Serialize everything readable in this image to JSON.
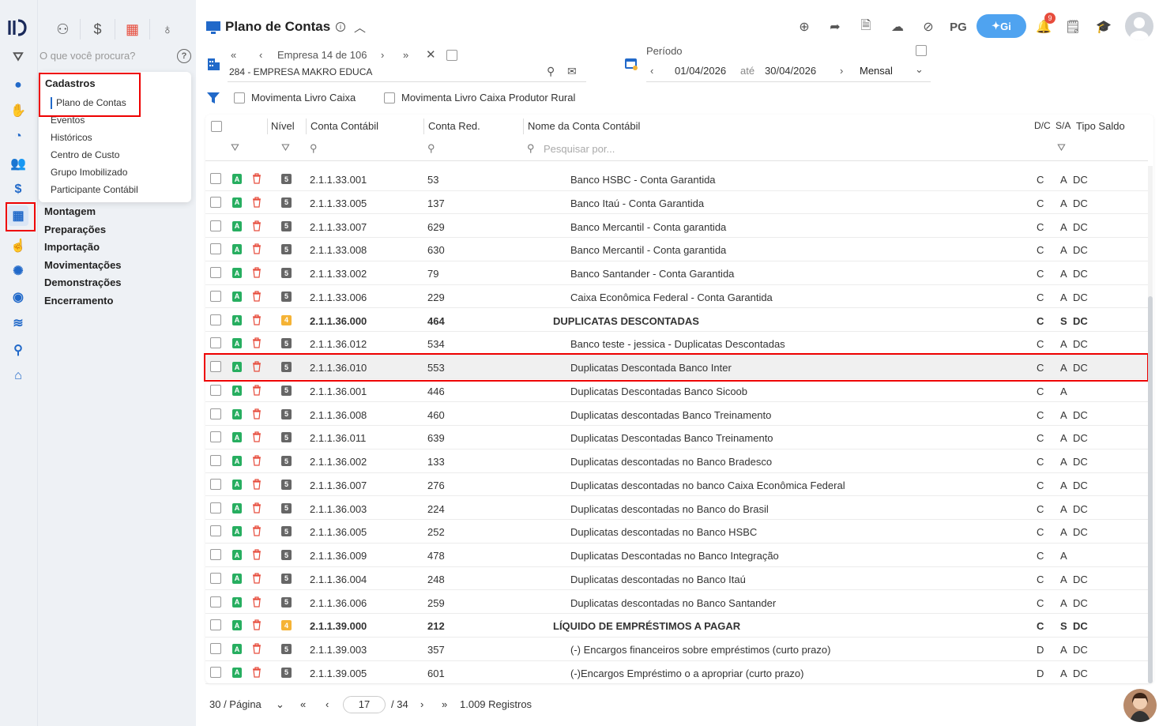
{
  "header": {
    "title": "Plano de Contas",
    "pg_label": "PG",
    "gi_label": "Gi",
    "notif_count": "9"
  },
  "search": {
    "placeholder": "O que você procura?"
  },
  "side_tabs": [
    "people",
    "dollar",
    "grid",
    "money-bag"
  ],
  "menu": {
    "heading": "Cadastros",
    "items": [
      "Plano de Contas",
      "Eventos",
      "Históricos",
      "Centro de Custo",
      "Grupo Imobilizado",
      "Participante Contábil"
    ]
  },
  "groups": [
    "Montagem",
    "Preparações",
    "Importação",
    "Movimentações",
    "Demonstrações",
    "Encerramento"
  ],
  "company": {
    "nav_text": "Empresa 14 de 106",
    "name": "284 - EMPRESA MAKRO EDUCA"
  },
  "period": {
    "label": "Período",
    "start": "01/04/2026",
    "until": "até",
    "end": "30/04/2026",
    "mode": "Mensal"
  },
  "filters": {
    "livro_caixa": "Movimenta Livro Caixa",
    "livro_rural": "Movimenta Livro Caixa Produtor Rural"
  },
  "columns": {
    "nivel": "Nível",
    "conta": "Conta Contábil",
    "red": "Conta Red.",
    "nome": "Nome da Conta Contábil",
    "dc": "D/C",
    "sa": "S/A",
    "tipo": "Tipo Saldo",
    "search_ph": "Pesquisar por..."
  },
  "rows": [
    {
      "lvl": "5",
      "conta": "2.1.1.33.001",
      "red": "53",
      "nome": "Banco HSBC - Conta Garantida",
      "dc": "C",
      "sa": "A",
      "tipo": "DC"
    },
    {
      "lvl": "5",
      "conta": "2.1.1.33.005",
      "red": "137",
      "nome": "Banco Itaú - Conta Garantida",
      "dc": "C",
      "sa": "A",
      "tipo": "DC"
    },
    {
      "lvl": "5",
      "conta": "2.1.1.33.007",
      "red": "629",
      "nome": "Banco Mercantil - Conta garantida",
      "dc": "C",
      "sa": "A",
      "tipo": "DC"
    },
    {
      "lvl": "5",
      "conta": "2.1.1.33.008",
      "red": "630",
      "nome": "Banco Mercantil - Conta garantida",
      "dc": "C",
      "sa": "A",
      "tipo": "DC"
    },
    {
      "lvl": "5",
      "conta": "2.1.1.33.002",
      "red": "79",
      "nome": "Banco Santander - Conta Garantida",
      "dc": "C",
      "sa": "A",
      "tipo": "DC"
    },
    {
      "lvl": "5",
      "conta": "2.1.1.33.006",
      "red": "229",
      "nome": "Caixa Econômica Federal - Conta Garantida",
      "dc": "C",
      "sa": "A",
      "tipo": "DC"
    },
    {
      "lvl": "4",
      "conta": "2.1.1.36.000",
      "red": "464",
      "nome": "DUPLICATAS DESCONTADAS",
      "dc": "C",
      "sa": "S",
      "tipo": "DC"
    },
    {
      "lvl": "5",
      "conta": "2.1.1.36.012",
      "red": "534",
      "nome": "Banco teste - jessica - Duplicatas Descontadas",
      "dc": "C",
      "sa": "A",
      "tipo": "DC"
    },
    {
      "lvl": "5",
      "conta": "2.1.1.36.010",
      "red": "553",
      "nome": "Duplicatas Descontada Banco Inter",
      "dc": "C",
      "sa": "A",
      "tipo": "DC"
    },
    {
      "lvl": "5",
      "conta": "2.1.1.36.001",
      "red": "446",
      "nome": "Duplicatas Descontadas Banco Sicoob",
      "dc": "C",
      "sa": "A",
      "tipo": ""
    },
    {
      "lvl": "5",
      "conta": "2.1.1.36.008",
      "red": "460",
      "nome": "Duplicatas descontadas Banco Treinamento",
      "dc": "C",
      "sa": "A",
      "tipo": "DC"
    },
    {
      "lvl": "5",
      "conta": "2.1.1.36.011",
      "red": "639",
      "nome": "Duplicatas Descontadas Banco Treinamento",
      "dc": "C",
      "sa": "A",
      "tipo": "DC"
    },
    {
      "lvl": "5",
      "conta": "2.1.1.36.002",
      "red": "133",
      "nome": "Duplicatas descontadas no Banco Bradesco",
      "dc": "C",
      "sa": "A",
      "tipo": "DC"
    },
    {
      "lvl": "5",
      "conta": "2.1.1.36.007",
      "red": "276",
      "nome": "Duplicatas descontadas no banco Caixa Econômica Federal",
      "dc": "C",
      "sa": "A",
      "tipo": "DC"
    },
    {
      "lvl": "5",
      "conta": "2.1.1.36.003",
      "red": "224",
      "nome": "Duplicatas descontadas no Banco do Brasil",
      "dc": "C",
      "sa": "A",
      "tipo": "DC"
    },
    {
      "lvl": "5",
      "conta": "2.1.1.36.005",
      "red": "252",
      "nome": "Duplicatas descontadas no Banco HSBC",
      "dc": "C",
      "sa": "A",
      "tipo": "DC"
    },
    {
      "lvl": "5",
      "conta": "2.1.1.36.009",
      "red": "478",
      "nome": "Duplicatas Descontadas no Banco Integração",
      "dc": "C",
      "sa": "A",
      "tipo": ""
    },
    {
      "lvl": "5",
      "conta": "2.1.1.36.004",
      "red": "248",
      "nome": "Duplicatas descontadas no Banco Itaú",
      "dc": "C",
      "sa": "A",
      "tipo": "DC"
    },
    {
      "lvl": "5",
      "conta": "2.1.1.36.006",
      "red": "259",
      "nome": "Duplicatas descontadas no Banco Santander",
      "dc": "C",
      "sa": "A",
      "tipo": "DC"
    },
    {
      "lvl": "4",
      "conta": "2.1.1.39.000",
      "red": "212",
      "nome": "LÍQUIDO DE EMPRÉSTIMOS A PAGAR",
      "dc": "C",
      "sa": "S",
      "tipo": "DC"
    },
    {
      "lvl": "5",
      "conta": "2.1.1.39.003",
      "red": "357",
      "nome": "(-) Encargos financeiros sobre empréstimos (curto prazo)",
      "dc": "D",
      "sa": "A",
      "tipo": "DC"
    },
    {
      "lvl": "5",
      "conta": "2.1.1.39.005",
      "red": "601",
      "nome": "(-)Encargos Empréstimo o a apropriar (curto prazo)",
      "dc": "D",
      "sa": "A",
      "tipo": "DC"
    }
  ],
  "highlighted_row": "2.1.1.36.010",
  "pager": {
    "per_page": "30 / Página",
    "current": "17",
    "total": "/ 34",
    "records": "1.009 Registros"
  },
  "colors": {
    "accent": "#2169c9",
    "level4": "#f5b335",
    "level5": "#666666",
    "active": "#27ae60",
    "delete": "#e74c3c",
    "highlight": "#e00000"
  }
}
